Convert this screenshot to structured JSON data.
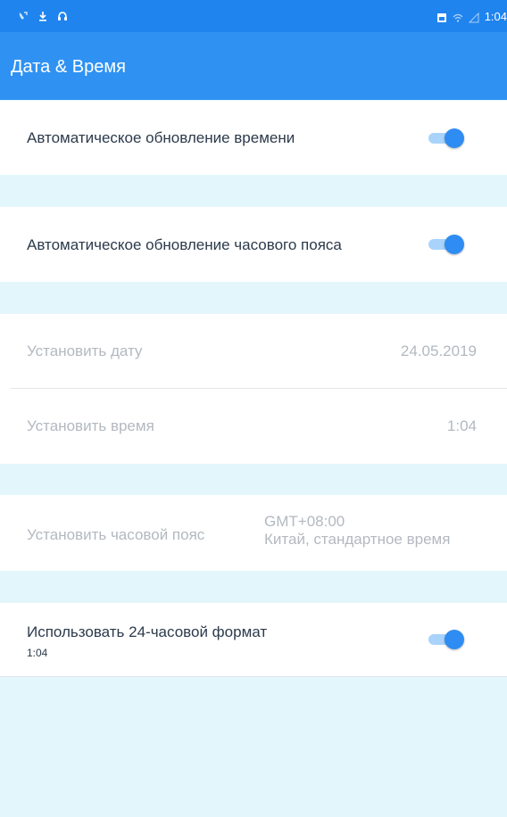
{
  "status_bar": {
    "time": "1:04",
    "left_icons": [
      "call-forward-icon",
      "download-icon",
      "headset-icon"
    ],
    "right_icons": [
      "sim-icon",
      "wifi-icon",
      "signal-icon"
    ]
  },
  "appbar": {
    "title": "Дата & Время"
  },
  "settings": {
    "auto_time": {
      "label": "Автоматическое обновление времени",
      "enabled": true
    },
    "auto_timezone": {
      "label": "Автоматическое обновление часового пояса",
      "enabled": true
    },
    "set_date": {
      "label": "Установить дату",
      "value": "24.05.2019"
    },
    "set_time": {
      "label": "Установить время",
      "value": "1:04"
    },
    "set_timezone": {
      "label": "Установить часовой пояс",
      "value_line1": "GMT+08:00",
      "value_line2": "Китай, стандартное время"
    },
    "format_24h": {
      "label": "Использовать 24-часовой формат",
      "sub": "1:04",
      "enabled": true
    }
  },
  "colors": {
    "appbar": "#2f92f3",
    "statusbar": "#1f84ee",
    "section_gap": "#e3f6fc",
    "toggle_on": "#2f8cf2"
  }
}
